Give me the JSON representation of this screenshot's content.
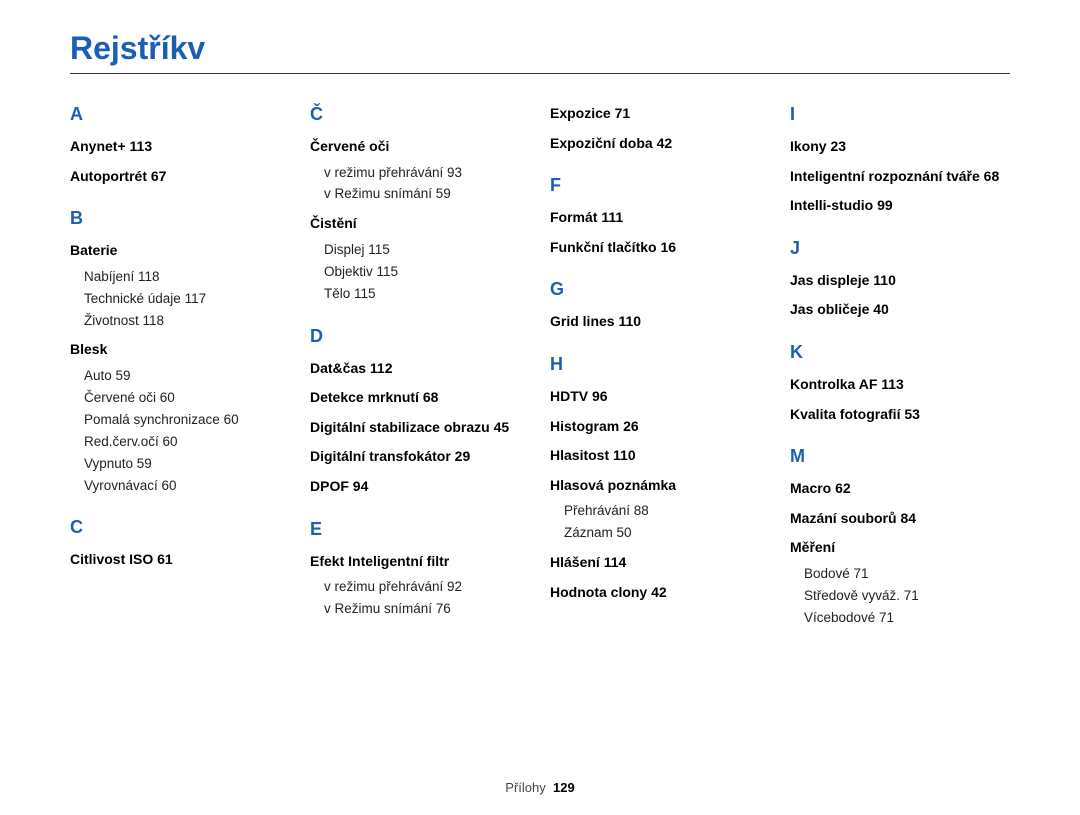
{
  "title": "Rejstříkv",
  "footer": {
    "label": "Přílohy",
    "page": "129"
  },
  "cols": [
    [
      {
        "type": "letter",
        "text": "A"
      },
      {
        "type": "entry",
        "text": "Anynet+  113"
      },
      {
        "type": "entry",
        "text": "Autoportrét  67"
      },
      {
        "type": "letter",
        "text": "B"
      },
      {
        "type": "entry",
        "text": "Baterie"
      },
      {
        "type": "sub",
        "text": "Nabíjení  118"
      },
      {
        "type": "sub",
        "text": "Technické údaje  117"
      },
      {
        "type": "sub",
        "text": "Životnost  118"
      },
      {
        "type": "entry",
        "text": "Blesk"
      },
      {
        "type": "sub",
        "text": "Auto  59"
      },
      {
        "type": "sub",
        "text": "Červené oči  60"
      },
      {
        "type": "sub",
        "text": "Pomalá synchronizace  60"
      },
      {
        "type": "sub",
        "text": "Red.červ.očí  60"
      },
      {
        "type": "sub",
        "text": "Vypnuto  59"
      },
      {
        "type": "sub",
        "text": "Vyrovnávací  60"
      },
      {
        "type": "letter",
        "text": "C"
      },
      {
        "type": "entry",
        "text": "Citlivost ISO  61"
      }
    ],
    [
      {
        "type": "letter",
        "text": "Č"
      },
      {
        "type": "entry",
        "text": "Červené oči"
      },
      {
        "type": "sub",
        "text": "v režimu přehrávání  93"
      },
      {
        "type": "sub",
        "text": "v Režimu snímání  59"
      },
      {
        "type": "entry",
        "text": "Čistění"
      },
      {
        "type": "sub",
        "text": "Displej  115"
      },
      {
        "type": "sub",
        "text": "Objektiv  115"
      },
      {
        "type": "sub",
        "text": "Tělo  115"
      },
      {
        "type": "letter",
        "text": "D"
      },
      {
        "type": "entry",
        "text": "Dat&čas  112"
      },
      {
        "type": "entry",
        "text": "Detekce mrknutí  68"
      },
      {
        "type": "entry",
        "text": "Digitální stabilizace obrazu  45"
      },
      {
        "type": "entry",
        "text": "Digitální transfokátor  29"
      },
      {
        "type": "entry",
        "text": "DPOF  94"
      },
      {
        "type": "letter",
        "text": "E"
      },
      {
        "type": "entry",
        "text": "Efekt Inteligentní filtr"
      },
      {
        "type": "sub",
        "text": "v režimu přehrávání  92"
      },
      {
        "type": "sub",
        "text": "v Režimu snímání  76"
      }
    ],
    [
      {
        "type": "entry",
        "text": "Expozice  71"
      },
      {
        "type": "entry",
        "text": "Expoziční doba  42"
      },
      {
        "type": "letter",
        "text": "F"
      },
      {
        "type": "entry",
        "text": "Formát  111"
      },
      {
        "type": "entry",
        "text": "Funkční tlačítko  16"
      },
      {
        "type": "letter",
        "text": "G"
      },
      {
        "type": "entry",
        "text": "Grid lines  110"
      },
      {
        "type": "letter",
        "text": "H"
      },
      {
        "type": "entry",
        "text": "HDTV  96"
      },
      {
        "type": "entry",
        "text": "Histogram  26"
      },
      {
        "type": "entry",
        "text": "Hlasitost  110"
      },
      {
        "type": "entry",
        "text": "Hlasová poznámka"
      },
      {
        "type": "sub",
        "text": "Přehrávání  88"
      },
      {
        "type": "sub",
        "text": "Záznam  50"
      },
      {
        "type": "entry",
        "text": "Hlášení  114"
      },
      {
        "type": "entry",
        "text": "Hodnota clony  42"
      }
    ],
    [
      {
        "type": "letter",
        "text": "I"
      },
      {
        "type": "entry",
        "text": "Ikony  23"
      },
      {
        "type": "entry",
        "text": "Inteligentní rozpoznání tváře  68"
      },
      {
        "type": "entry",
        "text": "Intelli-studio  99"
      },
      {
        "type": "letter",
        "text": "J"
      },
      {
        "type": "entry",
        "text": "Jas displeje  110"
      },
      {
        "type": "entry",
        "text": "Jas obličeje  40"
      },
      {
        "type": "letter",
        "text": "K"
      },
      {
        "type": "entry",
        "text": "Kontrolka AF  113"
      },
      {
        "type": "entry",
        "text": "Kvalita fotografií  53"
      },
      {
        "type": "letter",
        "text": "M"
      },
      {
        "type": "entry",
        "text": "Macro  62"
      },
      {
        "type": "entry",
        "text": "Mazání souborů  84"
      },
      {
        "type": "entry",
        "text": "Měření"
      },
      {
        "type": "sub",
        "text": "Bodové  71"
      },
      {
        "type": "sub",
        "text": "Středově vyváž.  71"
      },
      {
        "type": "sub",
        "text": "Vícebodové  71"
      }
    ]
  ]
}
